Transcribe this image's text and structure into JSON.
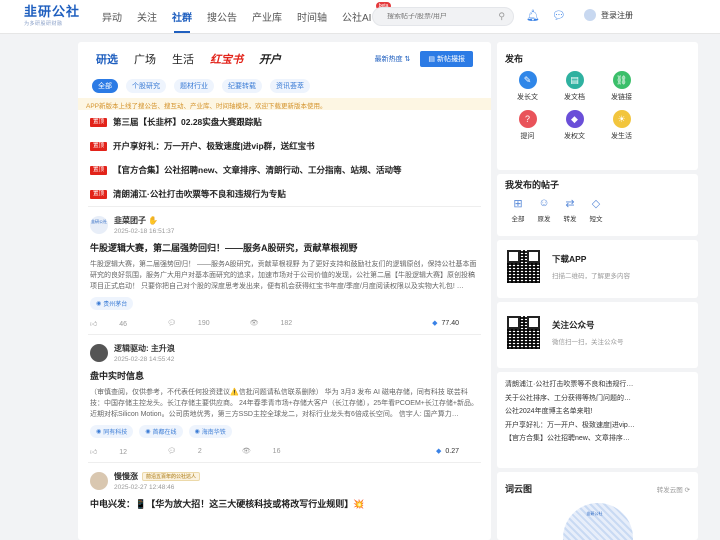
{
  "header": {
    "logo": "韭研公社",
    "logo_sub": "为多研股研财融",
    "nav": [
      "异动",
      "关注",
      "社群",
      "搜公告",
      "产业库",
      "时间轴",
      "公社AI"
    ],
    "nav_active": "社群",
    "beta": "beta",
    "search_placeholder": "搜索帖子/股票/用户",
    "login": "登录注册"
  },
  "main": {
    "tabs": [
      "研选",
      "广场",
      "生活",
      "红宝书",
      "开户"
    ],
    "sort": "最新热度",
    "new_post": "新帖撮报",
    "chips": [
      "全部",
      "个股研究",
      "题材行业",
      "纪要转载",
      "资讯荟萃"
    ],
    "notice": "APP新版本上线了搜公告、搜互动、产业库、时间轴模块，欢迎下载更新版本使用。",
    "pinned": [
      {
        "tag": "置顶",
        "title": "第三届【长韭杯】02.28实盘大赛跟踪贴"
      },
      {
        "tag": "置顶",
        "title": "开户享好礼：万一开户、极致速度|进vip群，送红宝书"
      },
      {
        "tag": "置顶",
        "title": "【官方合集】公社招聘new、文章排序、清朗行动、工分指南、站规、活动等"
      },
      {
        "tag": "置顶",
        "title": "清朗浦江·公社打击吹票等不良和违规行为专贴"
      }
    ],
    "posts": [
      {
        "author": "韭菜团子",
        "avatar_text": "韭研公社",
        "time": "2025-02-18 16:51:37",
        "title": "牛股逻辑大赛，第二届强势回归！——服务A股研究，贡献草根视野",
        "body": "牛股逻辑大赛，第二届强势回归！ ——服务A股研究，贡献草根视野 为了更好支持和鼓励社友们的逻辑原创，保持公社基本面研究的良好氛围，服务广大用户对基本面研究的追求，加速市场对于公司价值的发现，公社第二届【牛股逻辑大赛】原创投稿项目正式启动！ 只要你把自己对个股的深度思考发出来，便有机会获得红宝书年度/季度/月度阅读权限以及实物大礼包! …",
        "tags": [
          "贵州茅台"
        ],
        "likes": "46",
        "comments": "190",
        "views": "182",
        "coins": "77.40",
        "badge": ""
      },
      {
        "author": "逻辑驱动: 主升浪",
        "avatar_text": "",
        "time": "2025-02-28 14:55:42",
        "title": "盘中实时信息",
        "body": "（审慎查阅，仅供参考，不代表任何投资建议⚠️信批问题请私信联系删除） 华为 3月3 发布 AI 磁电存储，同有科技 联芸科技：中国存储主控龙头。长江存储主要供应商。 24年春季青市场+存储大客户（长江存储），25年看PCOEM+长江存储+新品。近期对标Silicon Motion。公司质地优秀，第三方SSD主控全球龙二，对标行业龙头有6倍成长空间。 信宇人: 国产算力…",
        "tags": [
          "同有科技",
          "首都在线",
          "海南华铁"
        ],
        "likes": "12",
        "comments": "2",
        "views": "16",
        "coins": "0.27",
        "badge": ""
      },
      {
        "author": "慢慢涨",
        "avatar_text": "",
        "time": "2025-02-27 12:48:46",
        "title": "中电兴发：📱【华为放大招！这三大硬核科技或将改写行业规则】💥",
        "body": "",
        "tags": [],
        "likes": "",
        "comments": "",
        "views": "",
        "coins": "",
        "badge": "前沿五百年的公社达人"
      }
    ]
  },
  "sidebar": {
    "publish_title": "发布",
    "publish": [
      {
        "label": "发长文",
        "icon": "pen-icon",
        "color": "#2f86e8"
      },
      {
        "label": "发文档",
        "icon": "document-icon",
        "color": "#2fb1a0"
      },
      {
        "label": "发链接",
        "icon": "link-icon",
        "color": "#3bbf6a"
      },
      {
        "label": "提问",
        "icon": "question-icon",
        "color": "#e9535a"
      },
      {
        "label": "发权文",
        "icon": "diamond-icon",
        "color": "#6a4fd8"
      },
      {
        "label": "发生活",
        "icon": "sun-icon",
        "color": "#f2c53d"
      }
    ],
    "myposts_title": "我发布的帖子",
    "myposts": [
      "全部",
      "原发",
      "转发",
      "短文"
    ],
    "app_title": "下载APP",
    "app_sub": "扫描二维码，了解更多内容",
    "wechat_title": "关注公众号",
    "wechat_sub": "微信扫一扫，关注公众号",
    "hot": [
      "清朗浦江·公社打击吹票等不良和违规行…",
      "关于公社排序、工分获得等热门问题的…",
      "公社2024年度博主名单来啦!",
      "开户享好礼：万一开户、极致速度|进vip…",
      "【官方合集】公社招聘new、文章排序…"
    ],
    "wordcloud_title": "词云图",
    "wordcloud_switch": "转发云图",
    "wordcloud_center": "韭研公社"
  }
}
